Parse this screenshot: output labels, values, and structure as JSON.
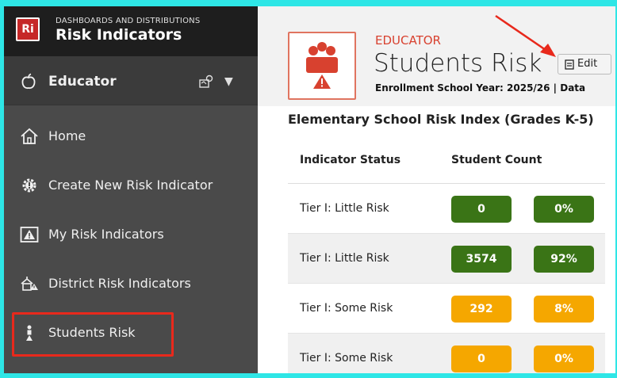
{
  "brand": {
    "logo_text": "Ri",
    "subtitle": "DASHBOARDS AND DISTRIBUTIONS",
    "title": "Risk Indicators"
  },
  "role": {
    "label": "Educator",
    "icon": "apple-icon",
    "tool_icon": "map-pin-icon"
  },
  "nav": [
    {
      "label": "Home",
      "icon": "home-icon"
    },
    {
      "label": "Create New Risk Indicator",
      "icon": "gear-alert-icon"
    },
    {
      "label": "My Risk Indicators",
      "icon": "warning-board-icon"
    },
    {
      "label": "District Risk Indicators",
      "icon": "school-alert-icon"
    },
    {
      "label": "Students Risk",
      "icon": "person-alert-icon"
    }
  ],
  "header": {
    "role": "EDUCATOR",
    "title": "Students Risk",
    "edit_label": "Edit",
    "enrollment": "Enrollment School Year: 2025/26 | Data"
  },
  "section_title": "Elementary School Risk Index (Grades K-5)",
  "table": {
    "headers": [
      "Indicator Status",
      "Student Count"
    ],
    "rows": [
      {
        "status": "Tier I: Little Risk",
        "count": "0",
        "pct": "0%",
        "color": "#3a7416"
      },
      {
        "status": "Tier I: Little Risk",
        "count": "3574",
        "pct": "92%",
        "color": "#3a7416"
      },
      {
        "status": "Tier I: Some Risk",
        "count": "292",
        "pct": "8%",
        "color": "#f5a700"
      },
      {
        "status": "Tier I: Some Risk",
        "count": "0",
        "pct": "0%",
        "color": "#f5a700"
      }
    ]
  },
  "colors": {
    "accent_red": "#d8412f",
    "green": "#3a7416",
    "amber": "#f5a700",
    "highlight": "#e8291c"
  }
}
